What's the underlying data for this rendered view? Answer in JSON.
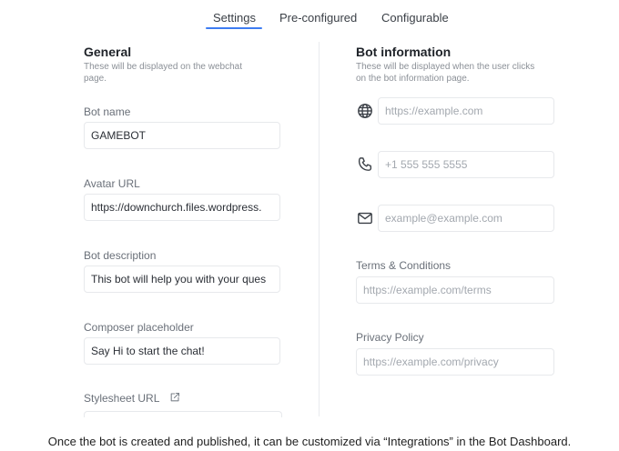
{
  "tabs": [
    {
      "label": "Settings",
      "active": true
    },
    {
      "label": "Pre-configured",
      "active": false
    },
    {
      "label": "Configurable",
      "active": false
    }
  ],
  "general": {
    "title": "General",
    "subtitle_line1": "These will be displayed on the webchat",
    "subtitle_line2": "page.",
    "bot_name_label": "Bot name",
    "bot_name_value": "GAMEBOT",
    "avatar_label": "Avatar URL",
    "avatar_value": "https://downchurch.files.wordpress.",
    "description_label": "Bot description",
    "description_value": "This bot will help you with your ques",
    "composer_label": "Composer placeholder",
    "composer_value": "Say Hi to start the chat!",
    "stylesheet_label": "Stylesheet URL"
  },
  "bot_info": {
    "title": "Bot information",
    "subtitle_line1": "These will be displayed when the user clicks",
    "subtitle_line2": "on the bot information page.",
    "website_placeholder": "https://example.com",
    "phone_placeholder": "+1 555 555 5555",
    "email_placeholder": "example@example.com",
    "terms_label": "Terms & Conditions",
    "terms_placeholder": "https://example.com/terms",
    "privacy_label": "Privacy Policy",
    "privacy_placeholder": "https://example.com/privacy"
  },
  "icons": {
    "website": "globe-icon",
    "phone": "phone-icon",
    "email": "mail-icon",
    "stylesheet": "external-link-icon"
  },
  "colors": {
    "accent": "#3d7cf2"
  },
  "caption": "Once the bot is created and published, it can be customized via “Integrations” in the Bot Dashboard."
}
